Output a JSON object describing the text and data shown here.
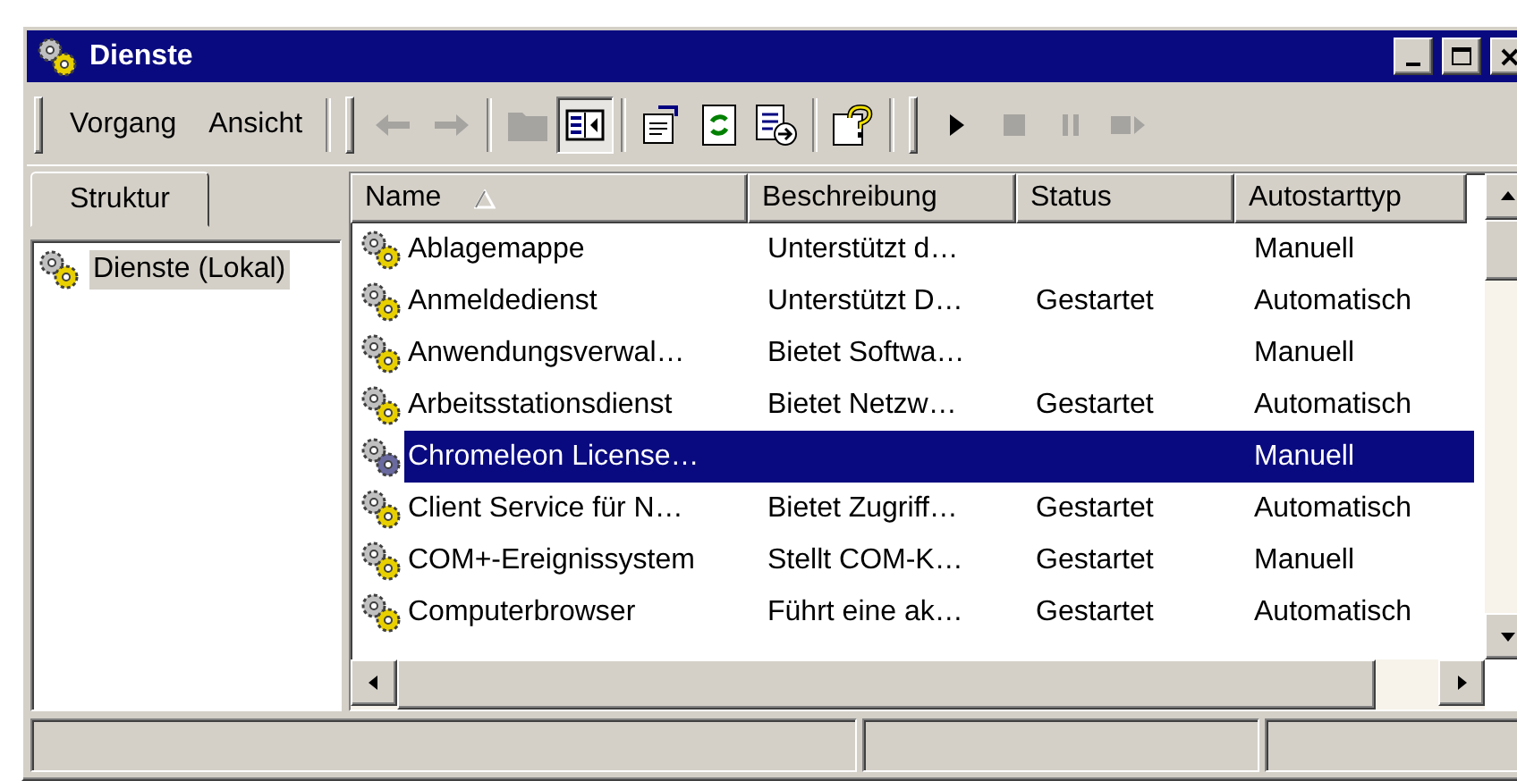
{
  "window": {
    "title": "Dienste"
  },
  "menu_bar": [
    {
      "label": "Vorgang"
    },
    {
      "label": "Ansicht"
    }
  ],
  "toolbars": [
    {
      "groups": [
        [
          {
            "kind": "back",
            "disabled": true,
            "pressed": false
          },
          {
            "kind": "forward",
            "disabled": true,
            "pressed": false
          }
        ],
        [
          {
            "kind": "folder",
            "disabled": true,
            "pressed": false
          },
          {
            "kind": "tree",
            "disabled": false,
            "pressed": true
          }
        ],
        [
          {
            "kind": "properties",
            "disabled": false,
            "pressed": false
          },
          {
            "kind": "refresh",
            "disabled": false,
            "pressed": false
          },
          {
            "kind": "export",
            "disabled": false,
            "pressed": false
          }
        ],
        [
          {
            "kind": "help",
            "disabled": false,
            "pressed": false
          }
        ]
      ]
    },
    {
      "groups": [
        [
          {
            "kind": "play",
            "disabled": false,
            "pressed": false
          },
          {
            "kind": "stop",
            "disabled": true,
            "pressed": false
          },
          {
            "kind": "pause",
            "disabled": true,
            "pressed": false
          },
          {
            "kind": "restart",
            "disabled": true,
            "pressed": false
          }
        ]
      ]
    }
  ],
  "tree_tabs": [
    {
      "label": "Struktur",
      "selected": true
    }
  ],
  "tree": [
    {
      "label": "Dienste (Lokal)",
      "selected": true
    }
  ],
  "table": {
    "columns": [
      {
        "label": "Name",
        "sorted": true
      },
      {
        "label": "Beschreibung",
        "sorted": false
      },
      {
        "label": "Status",
        "sorted": false
      },
      {
        "label": "Autostarttyp",
        "sorted": false
      }
    ],
    "rows": [
      {
        "name": "Ablagemappe",
        "description": "Unterstützt d…",
        "status": "",
        "startup": "Manuell",
        "selected": false
      },
      {
        "name": "Anmeldedienst",
        "description": "Unterstützt D…",
        "status": "Gestartet",
        "startup": "Automatisch",
        "selected": false
      },
      {
        "name": "Anwendungsverwal…",
        "description": "Bietet Softwa…",
        "status": "",
        "startup": "Manuell",
        "selected": false
      },
      {
        "name": "Arbeitsstationsdienst",
        "description": "Bietet Netzw…",
        "status": "Gestartet",
        "startup": "Automatisch",
        "selected": false
      },
      {
        "name": "Chromeleon License…",
        "description": "",
        "status": "",
        "startup": "Manuell",
        "selected": true
      },
      {
        "name": "Client Service für N…",
        "description": "Bietet Zugriff…",
        "status": "Gestartet",
        "startup": "Automatisch",
        "selected": false
      },
      {
        "name": "COM+-Ereignissystem",
        "description": "Stellt COM-K…",
        "status": "Gestartet",
        "startup": "Manuell",
        "selected": false
      },
      {
        "name": "Computerbrowser",
        "description": "Führt eine ak…",
        "status": "Gestartet",
        "startup": "Automatisch",
        "selected": false
      }
    ]
  }
}
